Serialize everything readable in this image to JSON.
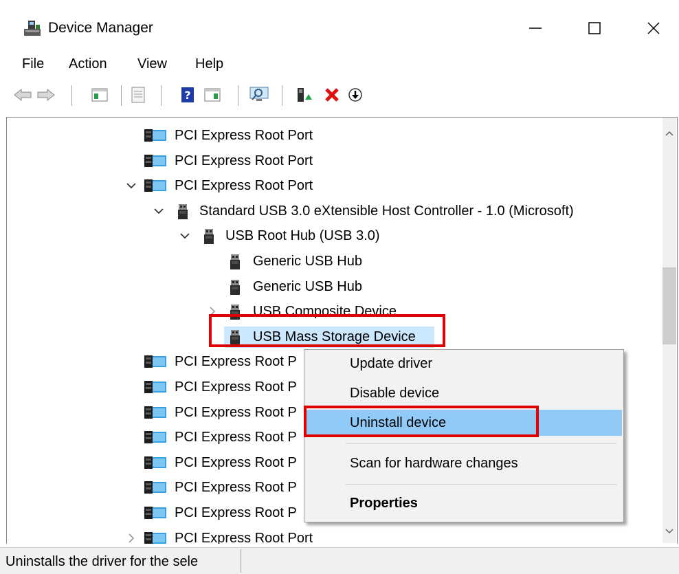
{
  "window": {
    "title": "Device Manager"
  },
  "menu": [
    "File",
    "Action",
    "View",
    "Help"
  ],
  "toolbar": {
    "buttons": [
      "back-icon",
      "forward-icon",
      "show-hide-console-tree-icon",
      "properties-icon",
      "help-icon",
      "show-action-pane-icon",
      "monitor-icon",
      "update-driver-icon",
      "uninstall-icon",
      "download-icon"
    ]
  },
  "tree": {
    "rows": [
      {
        "label": "PCI Express Root Port",
        "icon": "pci-device-icon"
      },
      {
        "label": "PCI Express Root Port",
        "icon": "pci-device-icon"
      },
      {
        "label": "PCI Express Root Port",
        "icon": "pci-device-icon",
        "expanded": true
      },
      {
        "label": "Standard USB 3.0 eXtensible Host Controller - 1.0 (Microsoft)",
        "icon": "usb-plug-icon",
        "expanded": true
      },
      {
        "label": "USB Root Hub (USB 3.0)",
        "icon": "usb-plug-icon",
        "expanded": true
      },
      {
        "label": "Generic USB Hub",
        "icon": "usb-plug-icon"
      },
      {
        "label": "Generic USB Hub",
        "icon": "usb-plug-icon"
      },
      {
        "label": "USB Composite Device",
        "icon": "usb-plug-icon",
        "collapsed": true
      },
      {
        "label": "USB Mass Storage Device",
        "icon": "usb-plug-icon",
        "selected": true
      },
      {
        "label": "PCI Express Root P",
        "icon": "pci-device-icon"
      },
      {
        "label": "PCI Express Root P",
        "icon": "pci-device-icon"
      },
      {
        "label": "PCI Express Root P",
        "icon": "pci-device-icon"
      },
      {
        "label": "PCI Express Root P",
        "icon": "pci-device-icon"
      },
      {
        "label": "PCI Express Root P",
        "icon": "pci-device-icon"
      },
      {
        "label": "PCI Express Root P",
        "icon": "pci-device-icon"
      },
      {
        "label": "PCI Express Root P",
        "icon": "pci-device-icon"
      },
      {
        "label": "PCI Express Root Port",
        "icon": "pci-device-icon",
        "collapsed": true
      }
    ]
  },
  "context_menu": {
    "items": [
      "Update driver",
      "Disable device",
      "Uninstall device",
      "Scan for hardware changes",
      "Properties"
    ],
    "highlighted": "Uninstall device"
  },
  "status": {
    "text": "Uninstalls the driver for the sele"
  },
  "colors": {
    "selection": "#cce8ff",
    "menu_highlight": "#91c9f7",
    "annotation": "#e00000"
  }
}
